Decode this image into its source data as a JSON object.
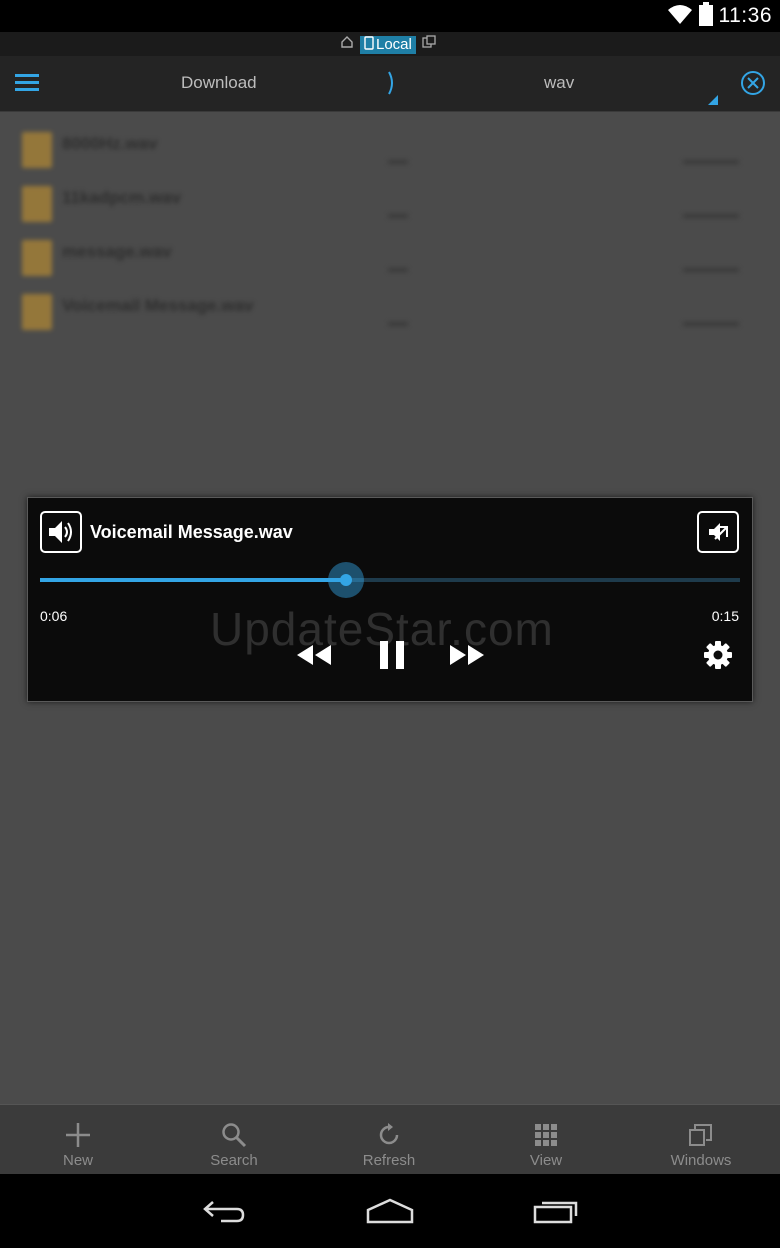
{
  "status_bar": {
    "time": "11:36",
    "icons": [
      "wifi-icon",
      "battery-icon"
    ]
  },
  "location_bar": {
    "home_icon": "home-icon",
    "local_label": "Local",
    "storage_icon": "phone-icon",
    "other_icon": "windows-small-icon"
  },
  "toolbar": {
    "menu_icon": "menu-icon",
    "crumbs": [
      "Download",
      "wav"
    ],
    "separator_icon": "chevron-right-icon",
    "close_icon": "close-circle-icon"
  },
  "files": [
    {
      "name": "8000Hz.wav"
    },
    {
      "name": "11kadpcm.wav"
    },
    {
      "name": "message.wav"
    },
    {
      "name": "Voicemail Message.wav"
    }
  ],
  "player": {
    "title": "Voicemail Message.wav",
    "elapsed": "0:06",
    "total": "0:15",
    "progress": 0.437,
    "watermark": "UpdateStar.com",
    "icons": {
      "speaker": "speaker-icon",
      "external": "open-external-icon",
      "rewind": "rewind-icon",
      "pause": "pause-icon",
      "forward": "fast-forward-icon",
      "settings": "gear-icon"
    }
  },
  "actions": [
    {
      "label": "New",
      "icon": "plus-icon"
    },
    {
      "label": "Search",
      "icon": "search-icon"
    },
    {
      "label": "Refresh",
      "icon": "refresh-icon"
    },
    {
      "label": "View",
      "icon": "grid-icon"
    },
    {
      "label": "Windows",
      "icon": "windows-icon"
    }
  ],
  "nav": [
    "back-icon",
    "home-icon",
    "recents-icon"
  ],
  "colors": {
    "accent": "#33a5e5",
    "local_badge": "#1f7fa6",
    "toolbar": "#242424",
    "overlay": "#4b4b4b"
  }
}
